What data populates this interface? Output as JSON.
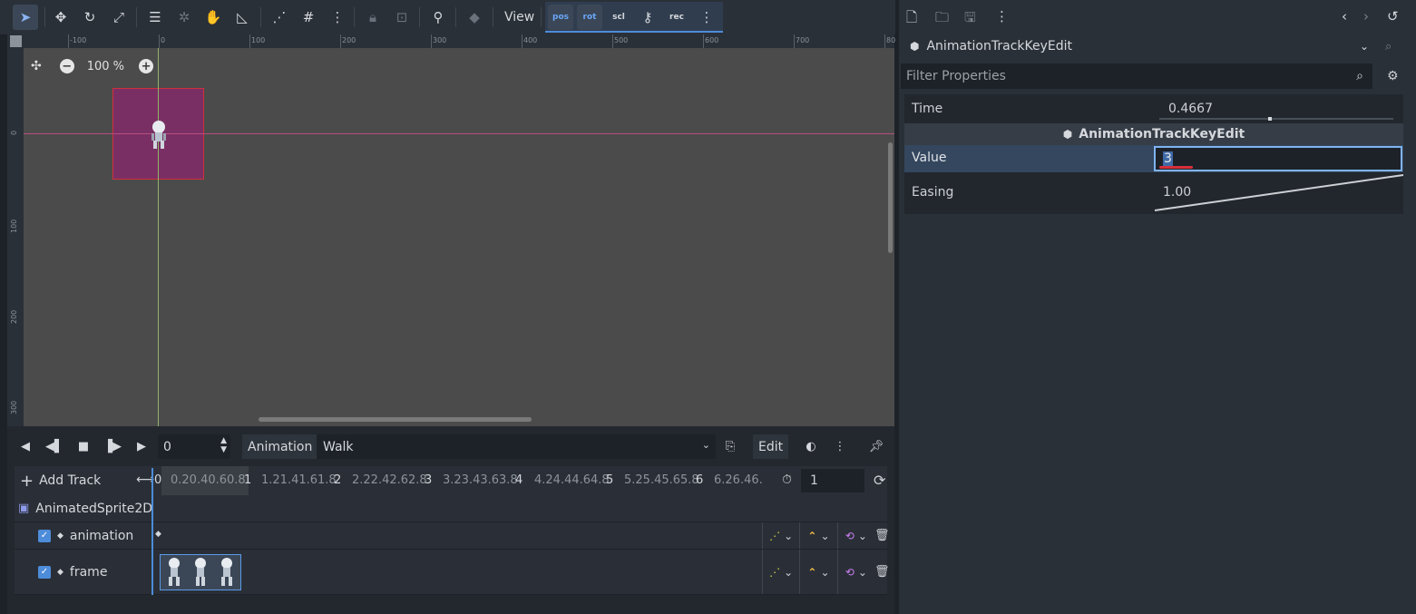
{
  "toolbar": {
    "view_label": "View",
    "pos_label": "pos",
    "rot_label": "rot",
    "scl_label": "scl",
    "rec_label": "rec"
  },
  "viewport": {
    "ruler_top_ticks": [
      "-100",
      "0",
      "100",
      "200",
      "300",
      "400",
      "500",
      "600",
      "700",
      "80"
    ],
    "ruler_left_ticks": [
      "0",
      "100",
      "200",
      "300"
    ],
    "zoom_label": "100 %"
  },
  "animation": {
    "current_time": "0",
    "animation_label": "Animation",
    "selected_animation": "Walk",
    "edit_label": "Edit",
    "add_track_label": "Add Track",
    "timeline_labels": [
      "0",
      "0.20.40.60.8",
      "1",
      "1.21.41.61.8",
      "2",
      "2.22.42.62.8",
      "3",
      "3.23.43.63.8",
      "4",
      "4.24.44.64.8",
      "5",
      "5.25.45.65.8",
      "6",
      "6.26.46."
    ],
    "length": "1",
    "node_name": "AnimatedSprite2D",
    "tracks": [
      {
        "name": "animation"
      },
      {
        "name": "frame"
      }
    ]
  },
  "inspector": {
    "class_name": "AnimationTrackKeyEdit",
    "filter_placeholder": "Filter Properties",
    "time_label": "Time",
    "time_value": "0.4667",
    "section_title": "AnimationTrackKeyEdit",
    "value_label": "Value",
    "value_value": "3",
    "easing_label": "Easing",
    "easing_value": "1.00"
  },
  "colors": {
    "accent": "#4d8cd9",
    "selection_rect": "#d0303a",
    "sprite_region": "#7a2f64"
  }
}
